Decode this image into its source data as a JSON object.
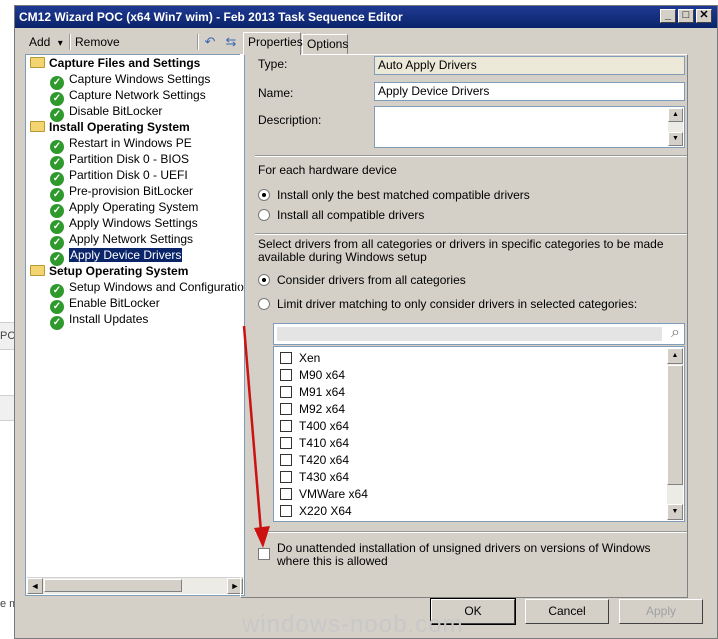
{
  "background": {
    "left_text_1": "PC",
    "left_text_2": "e m"
  },
  "window": {
    "title": "CM12 Wizard POC (x64 Win7 wim) - Feb 2013 Task Sequence Editor",
    "minimize_glyph": "_",
    "maximize_glyph": "□",
    "close_glyph": "✕"
  },
  "toolbar": {
    "add_label": "Add",
    "add_arrow": "▾",
    "remove_label": "Remove",
    "icon_glyph_1": "↶",
    "icon_glyph_2": "⇆"
  },
  "tree": {
    "groups": [
      {
        "label": "Capture Files and Settings",
        "items": [
          "Capture Windows Settings",
          "Capture Network Settings",
          "Disable BitLocker"
        ]
      },
      {
        "label": "Install Operating System",
        "items": [
          "Restart in Windows PE",
          "Partition Disk 0 - BIOS",
          "Partition Disk 0 - UEFI",
          "Pre-provision BitLocker",
          "Apply Operating System",
          "Apply Windows Settings",
          "Apply Network Settings",
          "Apply Device Drivers"
        ]
      },
      {
        "label": "Setup Operating System",
        "items": [
          "Setup Windows and Configuration",
          "Enable BitLocker",
          "Install Updates"
        ]
      }
    ],
    "selected_item": "Apply Device Drivers",
    "check_glyph": "✓",
    "scroll_left": "◄",
    "scroll_right": "►"
  },
  "tabs": {
    "properties": "Properties",
    "options": "Options"
  },
  "properties": {
    "type_label": "Type:",
    "type_value": "Auto Apply Drivers",
    "name_label": "Name:",
    "name_value": "Apply Device Drivers",
    "description_label": "Description:",
    "description_value": "",
    "hardware_heading": "For each hardware device",
    "radio_best": "Install only the best matched compatible drivers",
    "radio_all": "Install all compatible drivers",
    "category_heading": "Select drivers from all categories or drivers in specific categories to be made available during Windows setup",
    "radio_all_categories": "Consider drivers from all categories",
    "radio_limit": "Limit driver matching to only consider drivers in selected categories:",
    "search_glyph": "⌕",
    "categories": [
      "Xen",
      "M90 x64",
      "M91 x64",
      "M92 x64",
      "T400 x64",
      "T410 x64",
      "T420 x64",
      "T430 x64",
      "VMWare x64",
      "X220 X64"
    ],
    "unsigned_checkbox_label": "Do unattended installation of unsigned drivers on versions of Windows where this is allowed",
    "scroll_up": "▲",
    "scroll_down": "▼"
  },
  "buttons": {
    "ok": "OK",
    "cancel": "Cancel",
    "apply": "Apply"
  },
  "watermark": "windows-noob.com",
  "colors": {
    "title_bar": "#0a246a",
    "selection": "#0a246a",
    "annotation_arrow": "#cc1111",
    "check_icon": "#2e9a2e"
  }
}
